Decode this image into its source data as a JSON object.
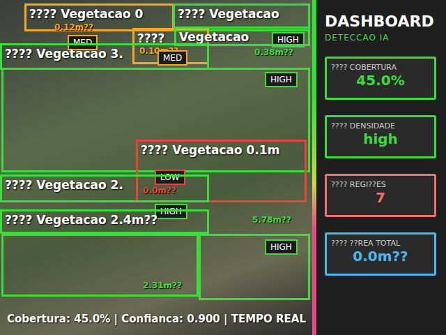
{
  "camera": {
    "detections": [
      {
        "label": "???? Vegetacao 0",
        "badge": "MED",
        "area": "0.12m??",
        "color": "#f5a623"
      },
      {
        "label": "???? Vegetacao",
        "badge": "HIGH",
        "color": "#3ddc3d"
      },
      {
        "label": "????",
        "badge": "MED",
        "area": "0.10m??",
        "color": "#f5a623"
      },
      {
        "label": "Vegetacao",
        "area": "0.38m??",
        "color": "#3ddc3d"
      },
      {
        "label": "???? Vegetacao 3.",
        "color": "#3ddc3d"
      },
      {
        "badge": "HIGH",
        "color": "#3ddc3d"
      },
      {
        "label": "???? Vegetacao 0.1m",
        "badge": "LOW",
        "area": "0.0m??",
        "color": "#e8453c"
      },
      {
        "label": "???? Vegetacao 2.",
        "badge": "HIGH",
        "color": "#3ddc3d"
      },
      {
        "label": "???? Vegetacao 2.4m??",
        "area": "5.78m??",
        "color": "#3ddc3d"
      },
      {
        "area": "2.31m??",
        "color": "#3ddc3d"
      },
      {
        "badge": "HIGH",
        "color": "#3ddc3d"
      }
    ]
  },
  "dashboard": {
    "title": "DASHBOARD",
    "subtitle": "DETECCAO IA",
    "cards": [
      {
        "label": "???? COBERTURA",
        "value": "45.0%",
        "color": "#3ddc3d"
      },
      {
        "label": "???? DENSIDADE",
        "value": "high",
        "color": "#3ddc3d"
      },
      {
        "label": "???? REGI??ES",
        "value": "7",
        "color": "#f07070"
      },
      {
        "label": "???? ??REA TOTAL",
        "value": "0.0m??",
        "color": "#4cb8f0"
      }
    ]
  },
  "status_bar": "Cobertura: 45.0% | Confianca: 0.900 | TEMPO REAL"
}
